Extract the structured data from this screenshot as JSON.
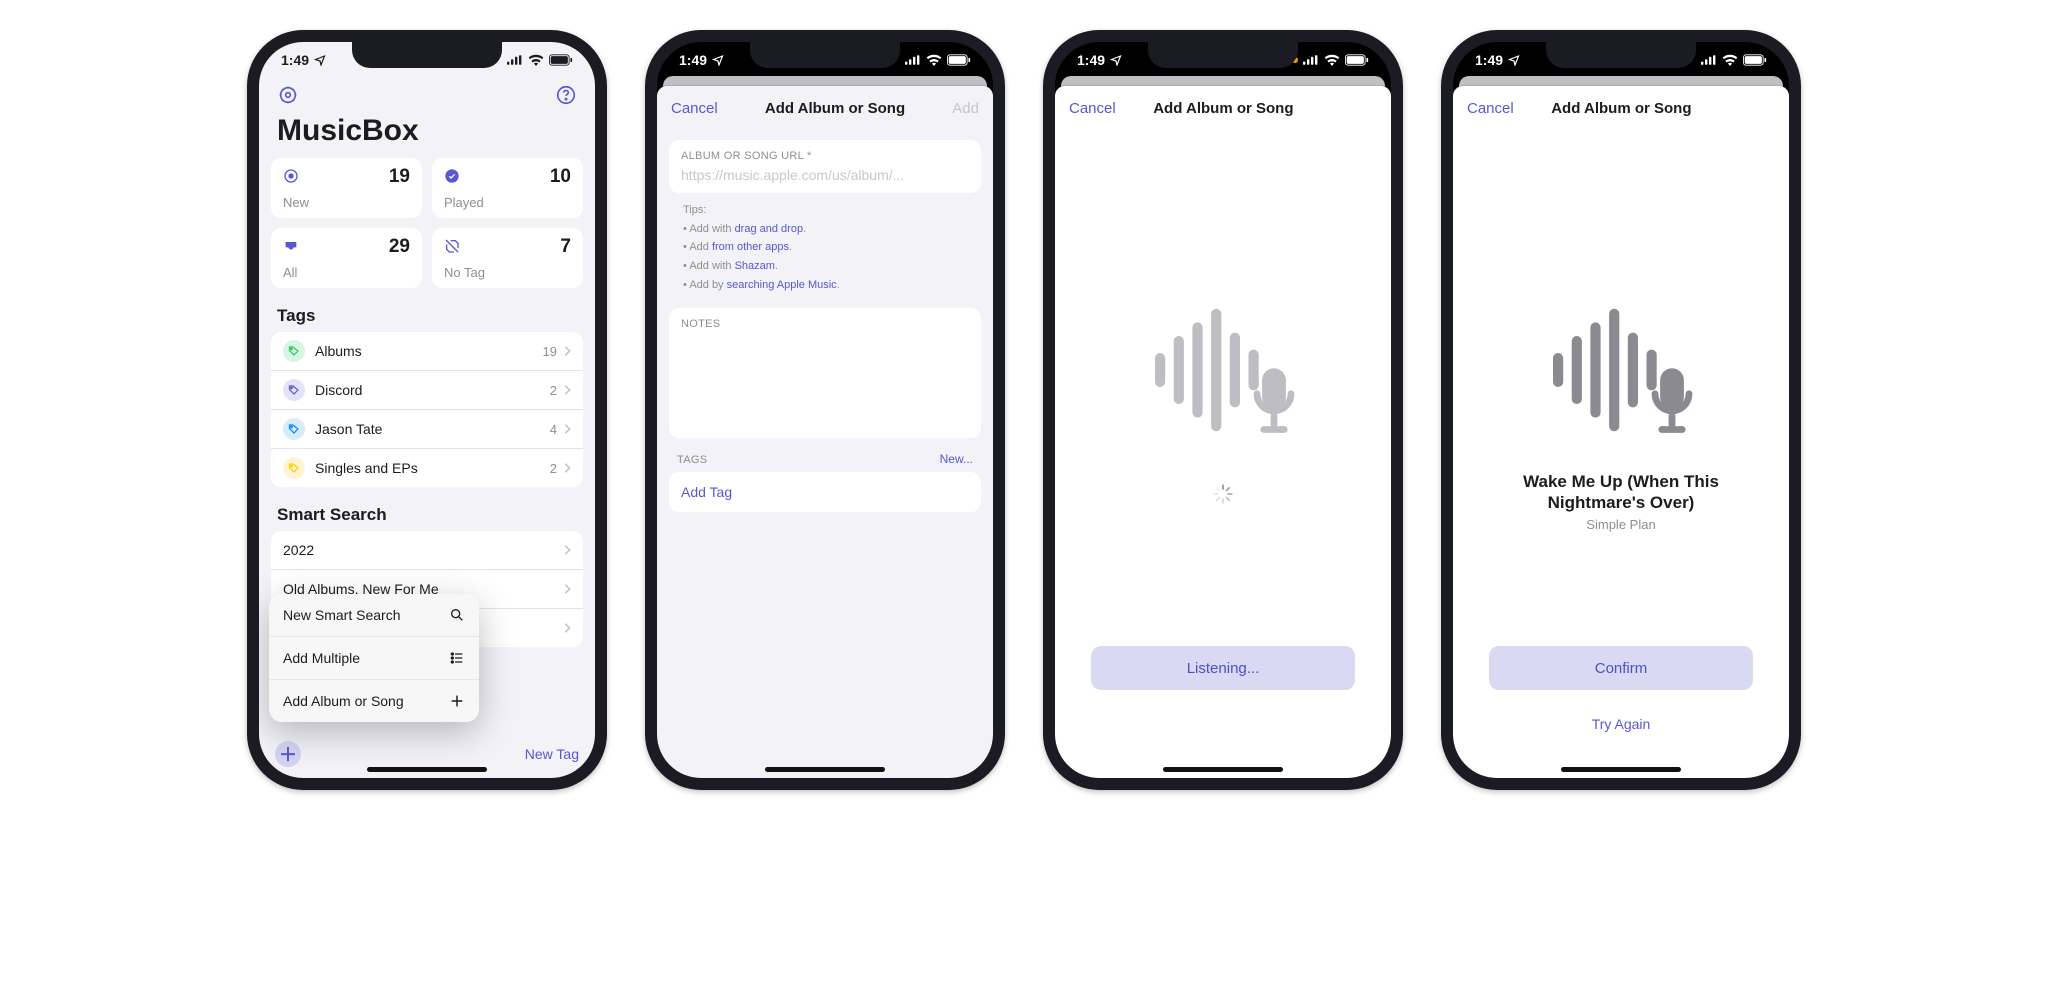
{
  "status": {
    "time": "1:49"
  },
  "screen1": {
    "app": "MusicBox",
    "cards": [
      {
        "label": "New",
        "count": "19"
      },
      {
        "label": "Played",
        "count": "10"
      },
      {
        "label": "All",
        "count": "29"
      },
      {
        "label": "No Tag",
        "count": "7"
      }
    ],
    "tags_header": "Tags",
    "tags": [
      {
        "name": "Albums",
        "count": "19"
      },
      {
        "name": "Discord",
        "count": "2"
      },
      {
        "name": "Jason Tate",
        "count": "4"
      },
      {
        "name": "Singles and EPs",
        "count": "2"
      }
    ],
    "smart_header": "Smart Search",
    "smart": [
      "2022",
      "Old Albums, New For Me",
      ""
    ],
    "menu": {
      "new_smart": "New Smart Search",
      "add_multiple": "Add Multiple",
      "add_album": "Add Album or Song"
    },
    "toolbar": {
      "new_tag": "New Tag"
    }
  },
  "screen2": {
    "cancel": "Cancel",
    "title": "Add Album or Song",
    "add": "Add",
    "url_label": "ALBUM OR SONG URL *",
    "url_placeholder": "https://music.apple.com/us/album/...",
    "tips": {
      "title": "Tips:",
      "l1a": "Add with ",
      "l1b": "drag and drop",
      "l1c": ".",
      "l2a": "Add ",
      "l2b": "from other apps",
      "l2c": ".",
      "l3a": "Add with ",
      "l3b": "Shazam",
      "l3c": ".",
      "l4a": "Add by ",
      "l4b": "searching Apple Music",
      "l4c": "."
    },
    "notes_label": "NOTES",
    "tags_label": "TAGS",
    "tags_new": "New...",
    "add_tag": "Add Tag"
  },
  "screen3": {
    "cancel": "Cancel",
    "title": "Add Album or Song",
    "listening": "Listening..."
  },
  "screen4": {
    "cancel": "Cancel",
    "title": "Add Album or Song",
    "song": "Wake Me Up (When This Nightmare's Over)",
    "artist": "Simple Plan",
    "confirm": "Confirm",
    "try_again": "Try Again"
  }
}
